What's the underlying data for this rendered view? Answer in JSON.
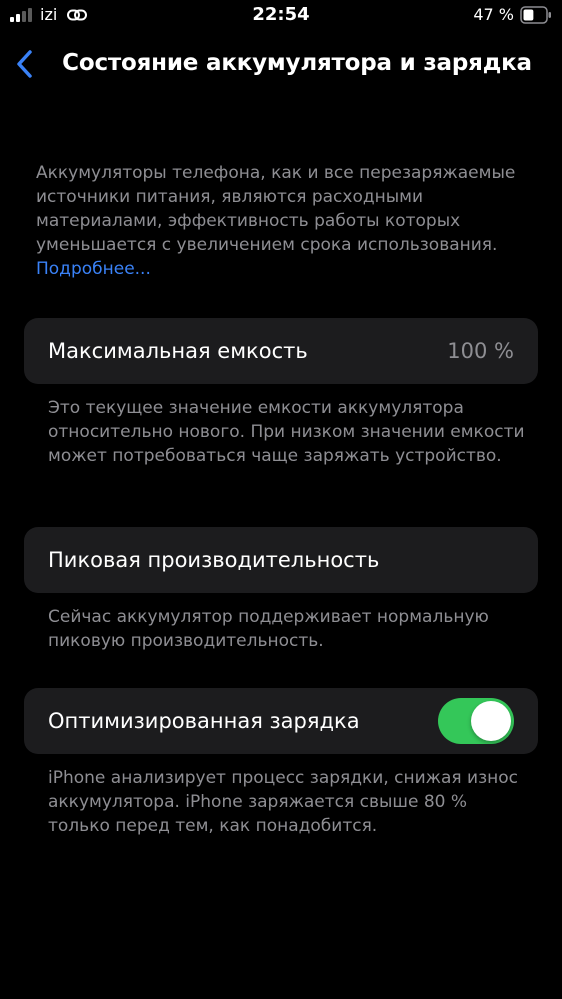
{
  "status_bar": {
    "carrier": "izi",
    "time": "22:54",
    "battery_percent": "47 %",
    "signal_icon": "cellular-signal-icon",
    "link_icon": "link-icon",
    "battery_icon": "battery-icon",
    "battery_level": 0.47
  },
  "nav": {
    "back_icon": "chevron-left-icon",
    "title": "Состояние аккумулятора и зарядка"
  },
  "intro": {
    "text": "Аккумуляторы телефона, как и все перезаряжаемые источники питания, являются расходными материалами, эффективность работы которых уменьшается с увеличением срока использования. ",
    "link": "Подробнее..."
  },
  "capacity": {
    "label": "Максимальная емкость",
    "value": "100 %",
    "footer": "Это текущее значение емкости аккумулятора относительно нового. При низком значении емкости может потребоваться чаще заряжать устройство."
  },
  "peak": {
    "label": "Пиковая производительность",
    "footer": "Сейчас аккумулятор поддерживает нормальную пиковую производительность."
  },
  "optimized": {
    "label": "Оптимизированная зарядка",
    "enabled": true,
    "footer": "iPhone анализирует процесс зарядки, снижая износ аккумулятора. iPhone заряжается свыше 80 % только перед тем, как понадобится."
  },
  "colors": {
    "background": "#000000",
    "card": "#1c1c1e",
    "secondary_text": "#8e8e93",
    "accent_blue": "#3a82f7",
    "toggle_on": "#34c759"
  }
}
